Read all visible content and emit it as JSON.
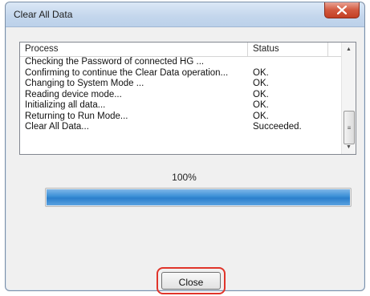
{
  "window": {
    "title": "Clear All Data",
    "close_glyph": "X"
  },
  "list": {
    "columns": {
      "process": "Process",
      "status": "Status"
    },
    "rows": [
      {
        "process": "Checking the Password of connected HG ...",
        "status": ""
      },
      {
        "process": "Confirming to continue the Clear Data operation...",
        "status": "OK."
      },
      {
        "process": "Changing to System Mode ...",
        "status": "OK."
      },
      {
        "process": "Reading device mode...",
        "status": "OK."
      },
      {
        "process": "Initializing all data...",
        "status": "OK."
      },
      {
        "process": "Returning to Run Mode...",
        "status": "OK."
      },
      {
        "process": "Clear All Data...",
        "status": "Succeeded."
      }
    ]
  },
  "progress": {
    "label": "100%",
    "value": 1.0
  },
  "buttons": {
    "close": "Close"
  },
  "colors": {
    "progress_fill": "#3a8fd6",
    "highlight": "#e0342a",
    "title_close": "#d2593f"
  },
  "icons": [
    "close-icon",
    "scroll-up-arrow-icon",
    "scroll-down-arrow-icon"
  ]
}
